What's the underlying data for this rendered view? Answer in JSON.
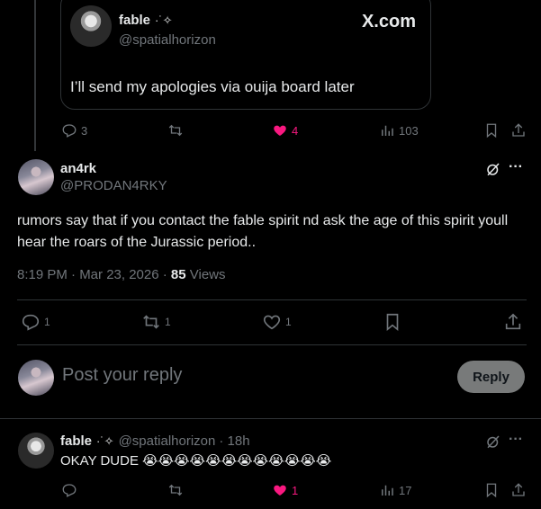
{
  "quoted": {
    "name": "fable",
    "name_glyph": "·˙✧",
    "handle": "@spatialhorizon",
    "watermark": "X.com",
    "text": "I’ll send my apologies via ouija board later"
  },
  "quoted_actions": {
    "replies": "3",
    "likes": "4",
    "views": "103"
  },
  "main_post": {
    "name": "an4rk",
    "handle": "@PRODAN4RKY",
    "text": "rumors say that if you contact the fable spirit nd ask the age of this spirit youll hear the roars of the Jurassic period..",
    "time": "8:19 PM · Mar 23, 2026 · ",
    "views_count": "85",
    "views_label": " Views",
    "replies": "1",
    "reposts": "1",
    "likes": "1"
  },
  "composer": {
    "placeholder": "Post your reply",
    "button": "Reply"
  },
  "reply": {
    "name": "fable",
    "name_glyph": "·˙✧",
    "handle": "@spatialhorizon",
    "time": "· 18h",
    "text": "OKAY DUDE",
    "emojis": "😭😭😭😭😭😭😭😭😭😭😭😭",
    "likes": "1",
    "views": "17"
  },
  "colors": {
    "like_active": "#f91880",
    "text": "#e7e9ea",
    "muted": "#71767b",
    "border": "#2f3336"
  }
}
